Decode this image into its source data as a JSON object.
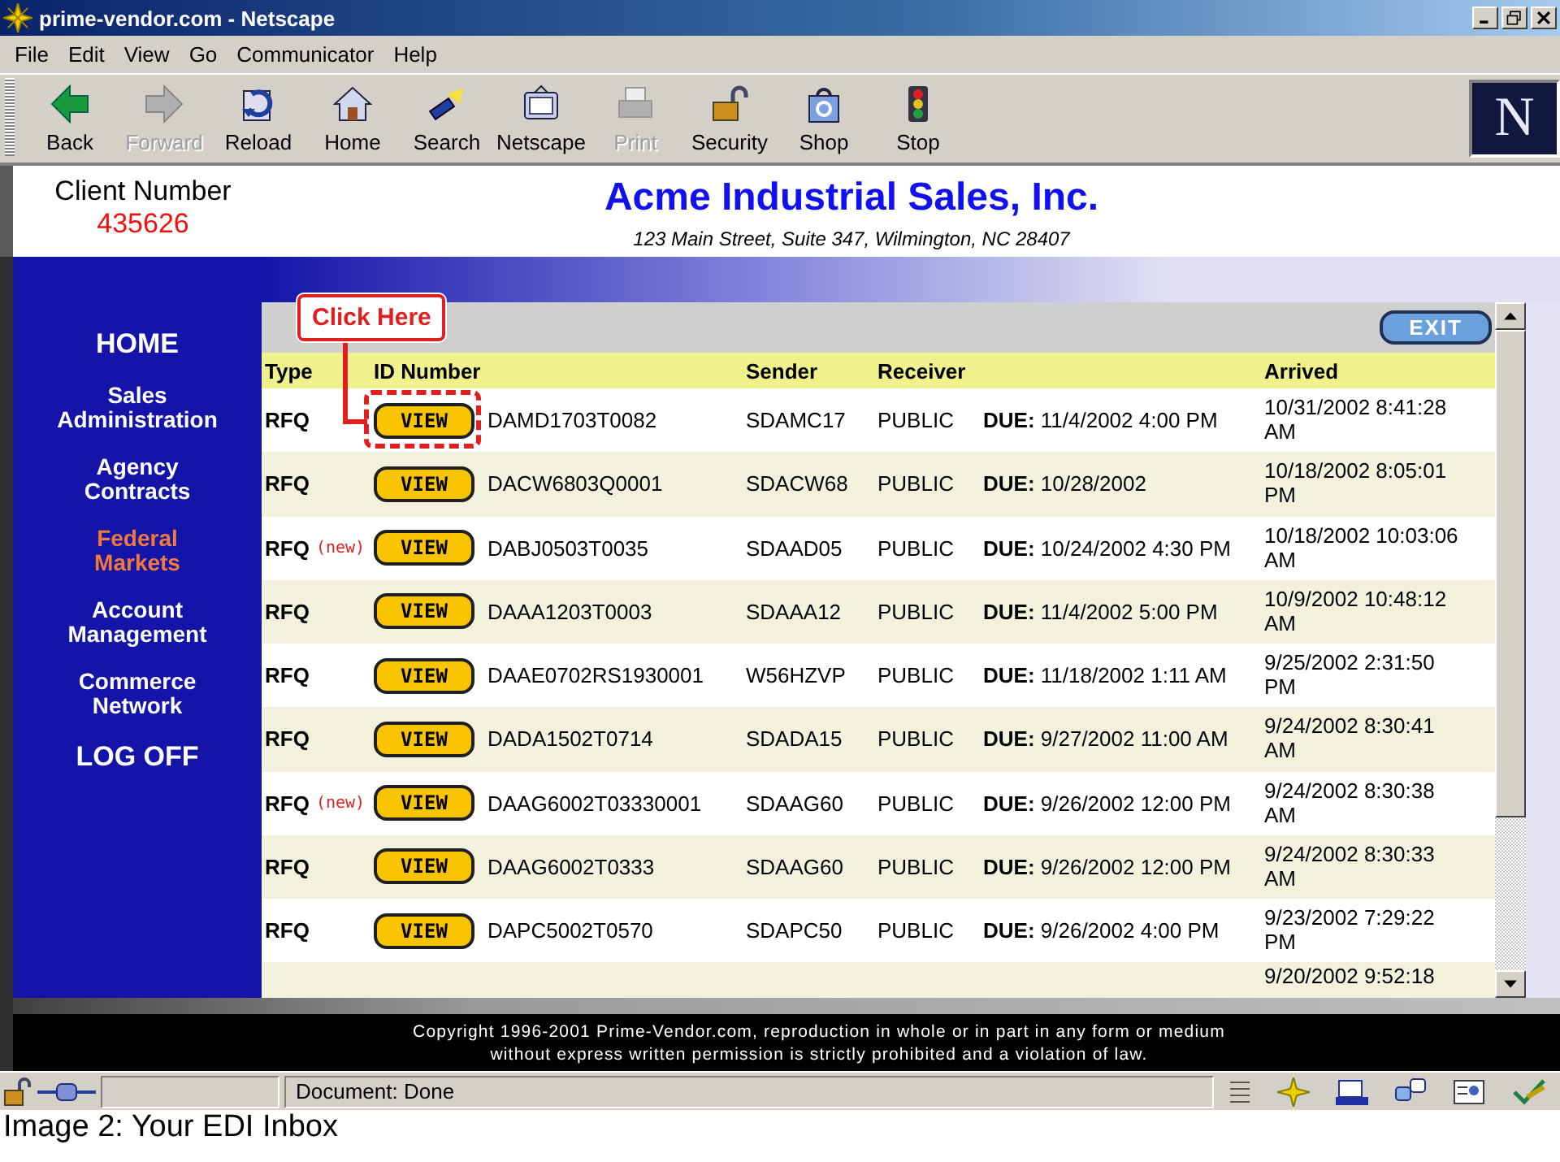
{
  "window": {
    "title": "prime-vendor.com - Netscape"
  },
  "menu": [
    "File",
    "Edit",
    "View",
    "Go",
    "Communicator",
    "Help"
  ],
  "toolbar": [
    {
      "label": "Back",
      "disabled": false
    },
    {
      "label": "Forward",
      "disabled": true
    },
    {
      "label": "Reload",
      "disabled": false
    },
    {
      "label": "Home",
      "disabled": false
    },
    {
      "label": "Search",
      "disabled": false
    },
    {
      "label": "Netscape",
      "disabled": false
    },
    {
      "label": "Print",
      "disabled": true
    },
    {
      "label": "Security",
      "disabled": false
    },
    {
      "label": "Shop",
      "disabled": false
    },
    {
      "label": "Stop",
      "disabled": false
    }
  ],
  "logo": "N",
  "header": {
    "client_label": "Client Number",
    "client_number": "435626",
    "company": "Acme Industrial Sales, Inc.",
    "address": "123 Main Street, Suite 347, Wilmington, NC 28407"
  },
  "sidebar": {
    "items": [
      {
        "label": "HOME",
        "kind": "main",
        "selected": false
      },
      {
        "label": "Sales Administration",
        "kind": "section",
        "selected": false
      },
      {
        "label": "Agency Contracts",
        "kind": "section",
        "selected": false
      },
      {
        "label": "Federal Markets",
        "kind": "section",
        "selected": true
      },
      {
        "label": "Account Management",
        "kind": "section",
        "selected": false
      },
      {
        "label": "Commerce Network",
        "kind": "section",
        "selected": false
      },
      {
        "label": "LOG OFF",
        "kind": "main",
        "selected": false
      }
    ]
  },
  "inbox": {
    "exit": "EXIT",
    "callout": "Click Here",
    "columns": [
      "Type",
      "ID Number",
      "Sender",
      "Receiver",
      "Arrived"
    ],
    "rows": [
      {
        "type": "RFQ",
        "view": "VIEW",
        "id": "DAMD1703T0082",
        "sender": "SDAMC17",
        "receiver": "PUBLIC",
        "due": "**DUE:** 11/4/2002 4:00 PM",
        "arrived": "10/31/2002 8:41:28 AM"
      },
      {
        "type": "RFQ",
        "view": "VIEW",
        "id": "DACW6803Q0001",
        "sender": "SDACW68",
        "receiver": "PUBLIC",
        "due": "**DUE:** 10/28/2002",
        "arrived": "10/18/2002 8:05:01 PM"
      },
      {
        "type": "RFQ",
        "tag": "(new)",
        "view": "VIEW",
        "id": "DABJ0503T0035",
        "sender": "SDAAD05",
        "receiver": "PUBLIC",
        "due": "**DUE:** 10/24/2002 4:30 PM",
        "arrived": "10/18/2002 10:03:06 AM"
      },
      {
        "type": "RFQ",
        "view": "VIEW",
        "id": "DAAA1203T0003",
        "sender": "SDAAA12",
        "receiver": "PUBLIC",
        "due": "**DUE:** 11/4/2002 5:00 PM",
        "arrived": "10/9/2002 10:48:12 AM"
      },
      {
        "type": "RFQ",
        "view": "VIEW",
        "id": "DAAE0702RS1930001",
        "sender": "W56HZVP",
        "receiver": "PUBLIC",
        "due": "**DUE:** 11/18/2002 1:11 AM",
        "arrived": "9/25/2002 2:31:50 PM"
      },
      {
        "type": "RFQ",
        "view": "VIEW",
        "id": "DADA1502T0714",
        "sender": "SDADA15",
        "receiver": "PUBLIC",
        "due": "**DUE:** 9/27/2002 11:00 AM",
        "arrived": "9/24/2002 8:30:41 AM"
      },
      {
        "type": "RFQ",
        "tag": "(new)",
        "view": "VIEW",
        "id": "DAAG6002T03330001",
        "sender": "SDAAG60",
        "receiver": "PUBLIC",
        "due": "**DUE:** 9/26/2002 12:00 PM",
        "arrived": "9/24/2002 8:30:38 AM"
      },
      {
        "type": "RFQ",
        "view": "VIEW",
        "id": "DAAG6002T0333",
        "sender": "SDAAG60",
        "receiver": "PUBLIC",
        "due": "**DUE:** 9/26/2002 12:00 PM",
        "arrived": "9/24/2002 8:30:33 AM"
      },
      {
        "type": "RFQ",
        "view": "VIEW",
        "id": "DAPC5002T0570",
        "sender": "SDAPC50",
        "receiver": "PUBLIC",
        "due": "**DUE:** 9/26/2002 4:00 PM",
        "arrived": "9/23/2002 7:29:22 PM"
      },
      {
        "arrived": "9/20/2002 9:52:18"
      }
    ]
  },
  "footer": {
    "copyright": "Copyright 1996-2001 Prime-Vendor.com, reproduction in whole or in part in any form or medium without express written permission is strictly prohibited and a violation of law."
  },
  "status_bar": {
    "text": "Document: Done"
  },
  "caption": "Image 2: Your EDI Inbox"
}
